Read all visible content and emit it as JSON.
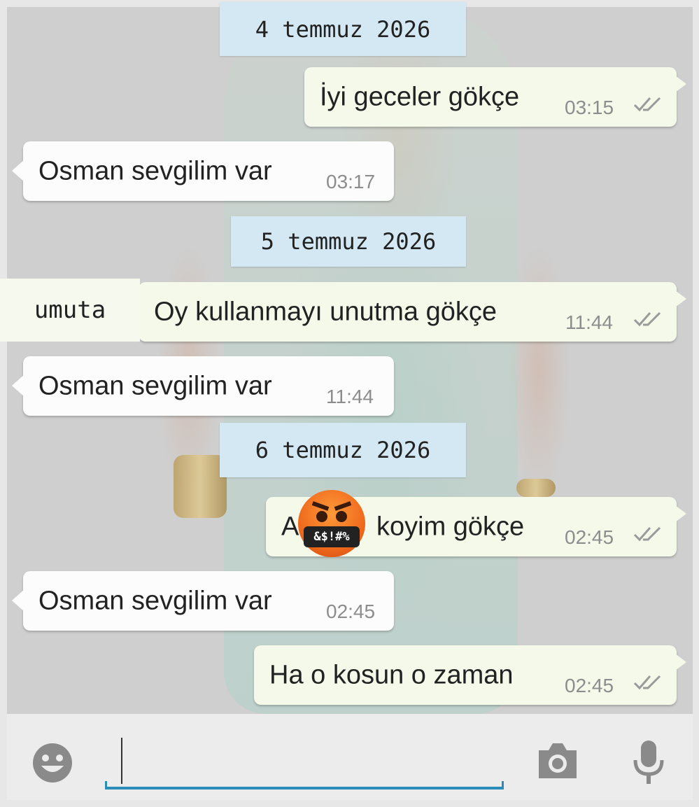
{
  "chat": {
    "dates": [
      "4 temmuz 2026",
      "5 temmuz 2026",
      "6 temmuz 2026"
    ],
    "messages": [
      {
        "text": "İyi geceler gökçe",
        "time": "03:15"
      },
      {
        "text": "Osman sevgilim var",
        "time": "03:17"
      },
      {
        "text": "Oy kullanmayı unutma gökçe",
        "time": "11:44"
      },
      {
        "text": "Osman sevgilim var",
        "time": "11:44"
      },
      {
        "text_prefix": "A",
        "text": "koyim gökçe",
        "time": "02:45"
      },
      {
        "text": "Osman sevgilim var",
        "time": "02:45"
      },
      {
        "text": "Ha o kosun o zaman",
        "time": "02:45"
      }
    ],
    "overlay_label": "umuta",
    "censor_text": "&$!#%"
  },
  "inputbar": {
    "emoji_icon": "smiley-face-icon",
    "camera_icon": "camera-icon",
    "mic_icon": "microphone-icon",
    "accent_color": "#2a8cb8"
  }
}
